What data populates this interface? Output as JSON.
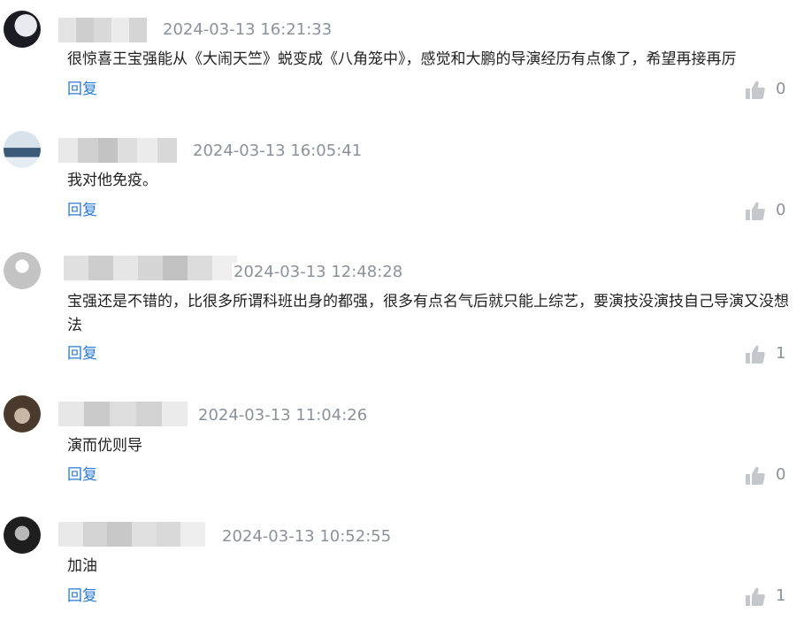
{
  "comments": [
    {
      "time": "2024-03-13 16:21:33",
      "text": "很惊喜王宝强能从《大闹天竺》蜕变成《八角笼中》，感觉和大鹏的导演经历有点像了，希望再接再厉",
      "reply_label": "回复",
      "likes": "0",
      "avatar_colors": [
        "#1b1b23",
        "#c9ccd6"
      ]
    },
    {
      "time": "2024-03-13 16:05:41",
      "text": "我对他免疫。",
      "reply_label": "回复",
      "likes": "0",
      "avatar_colors": [
        "#3a5a78",
        "#d8e2ea"
      ]
    },
    {
      "time": "2024-03-13 12:48:28",
      "text": "宝强还是不错的，比很多所谓科班出身的都强，很多有点名气后就只能上综艺，要演技没演技自己导演又没想法",
      "reply_label": "回复",
      "likes": "1",
      "avatar_colors": [
        "#c4c4c4",
        "#e6e6e6"
      ]
    },
    {
      "time": "2024-03-13 11:04:26",
      "text": "演而优则导",
      "reply_label": "回复",
      "likes": "0",
      "avatar_colors": [
        "#4a3a2e",
        "#c7b8a6"
      ]
    },
    {
      "time": "2024-03-13 10:52:55",
      "text": "加油",
      "reply_label": "回复",
      "likes": "1",
      "avatar_colors": [
        "#1e1e1e",
        "#b8b8b8"
      ]
    }
  ],
  "colors": {
    "reply_link": "#2b7bd0",
    "timestamp": "#8a929c",
    "like_icon": "#c4c7cc"
  },
  "icons": {
    "like": "thumbs-up-icon"
  }
}
